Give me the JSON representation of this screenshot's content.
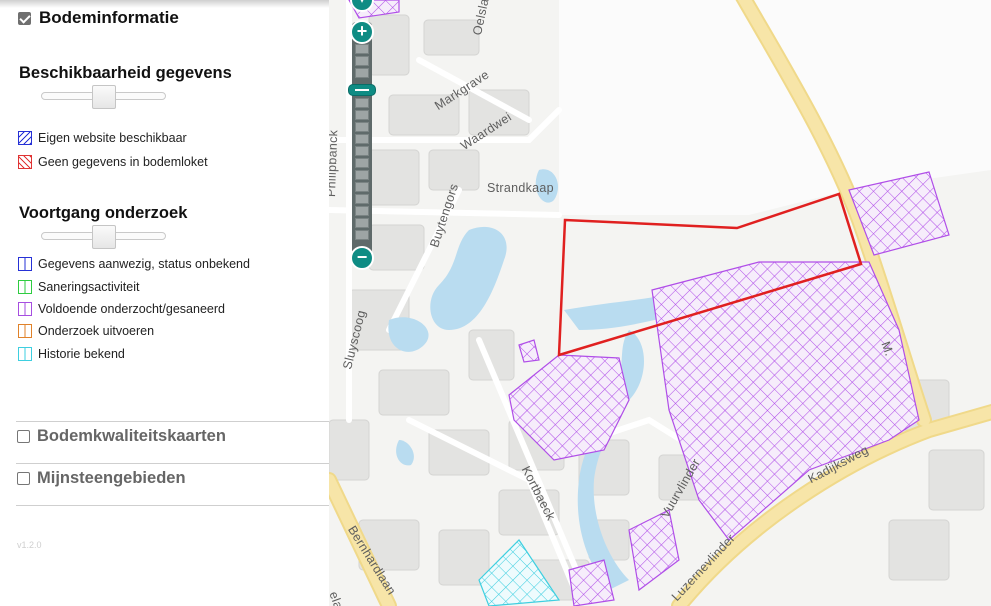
{
  "panel": {
    "main_layer": {
      "label": "Bodeminformatie",
      "checked": true
    },
    "availability": {
      "title": "Beschikbaarheid gegevens",
      "legend": [
        {
          "label": "Eigen website beschikbaar",
          "color": "#2631d6"
        },
        {
          "label": "Geen gegevens in bodemloket",
          "color": "#e03333"
        }
      ]
    },
    "progress": {
      "title": "Voortgang onderzoek",
      "legend": [
        {
          "label": "Gegevens aanwezig, status onbekend",
          "color": "#2631d6"
        },
        {
          "label": "Saneringsactiviteit",
          "color": "#2ecc40"
        },
        {
          "label": "Voldoende onderzocht/gesaneerd",
          "color": "#a64ee0"
        },
        {
          "label": "Onderzoek uitvoeren",
          "color": "#e0822a"
        },
        {
          "label": "Historie bekend",
          "color": "#3ecfe0"
        }
      ]
    },
    "other_layers": [
      {
        "label": "Bodemkwaliteitskaarten",
        "checked": false
      },
      {
        "label": "Mijnsteengebieden",
        "checked": false
      }
    ],
    "version": "v1.2.0"
  },
  "map": {
    "street_labels": [
      "Markgrave",
      "Waardwei",
      "Strandkaap",
      "Buytengors",
      "Sluyscoog",
      "Kortbaeck",
      "Vuurvlinder",
      "Luzernevlinder",
      "Kadijksweg",
      "Bernhardlaan",
      "Philipbanck",
      "Oelslag",
      "M.",
      "elaan"
    ],
    "colors": {
      "water": "#b9dcf0",
      "main_road": "#f7e5a8",
      "selection_outline": "#e02020",
      "hatch_purple": "#b04ee8",
      "hatch_cyan": "#3ecfe0"
    }
  },
  "zoom": {
    "plus": "+",
    "minus": "−"
  }
}
